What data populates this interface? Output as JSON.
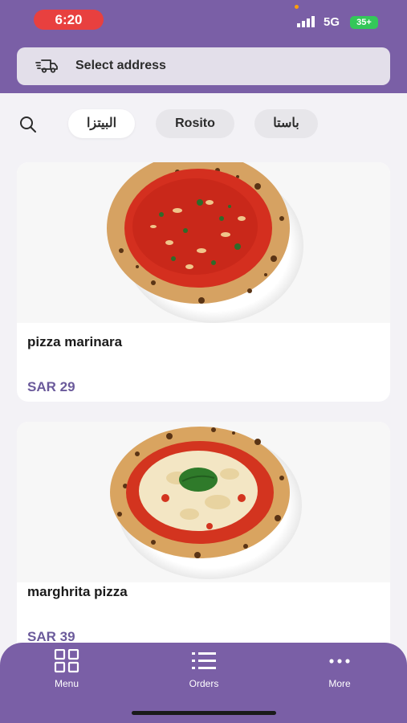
{
  "status_bar": {
    "time": "6:20",
    "network": "5G",
    "battery": "35+"
  },
  "address_bar": {
    "label": "Select address",
    "icon": "delivery-truck-icon"
  },
  "categories": [
    {
      "label": "البيتزا",
      "active": true
    },
    {
      "label": "Rosito",
      "active": false
    },
    {
      "label": "باستا",
      "active": false
    }
  ],
  "search": {
    "icon": "search-icon"
  },
  "menu_items": [
    {
      "name": "pizza marinara",
      "price": "SAR 29",
      "image": "pizza-marinara-photo"
    },
    {
      "name": "marghrita pizza",
      "price": "SAR 39",
      "image": "margherita-pizza-photo"
    }
  ],
  "bottom_nav": {
    "items": [
      {
        "label": "Menu",
        "icon": "grid-icon"
      },
      {
        "label": "Orders",
        "icon": "list-icon"
      },
      {
        "label": "More",
        "icon": "more-dots-icon"
      }
    ]
  },
  "colors": {
    "brand": "#7a5fa6",
    "price": "#6b5a9b",
    "time_pill": "#e8403f",
    "battery": "#34c759"
  }
}
